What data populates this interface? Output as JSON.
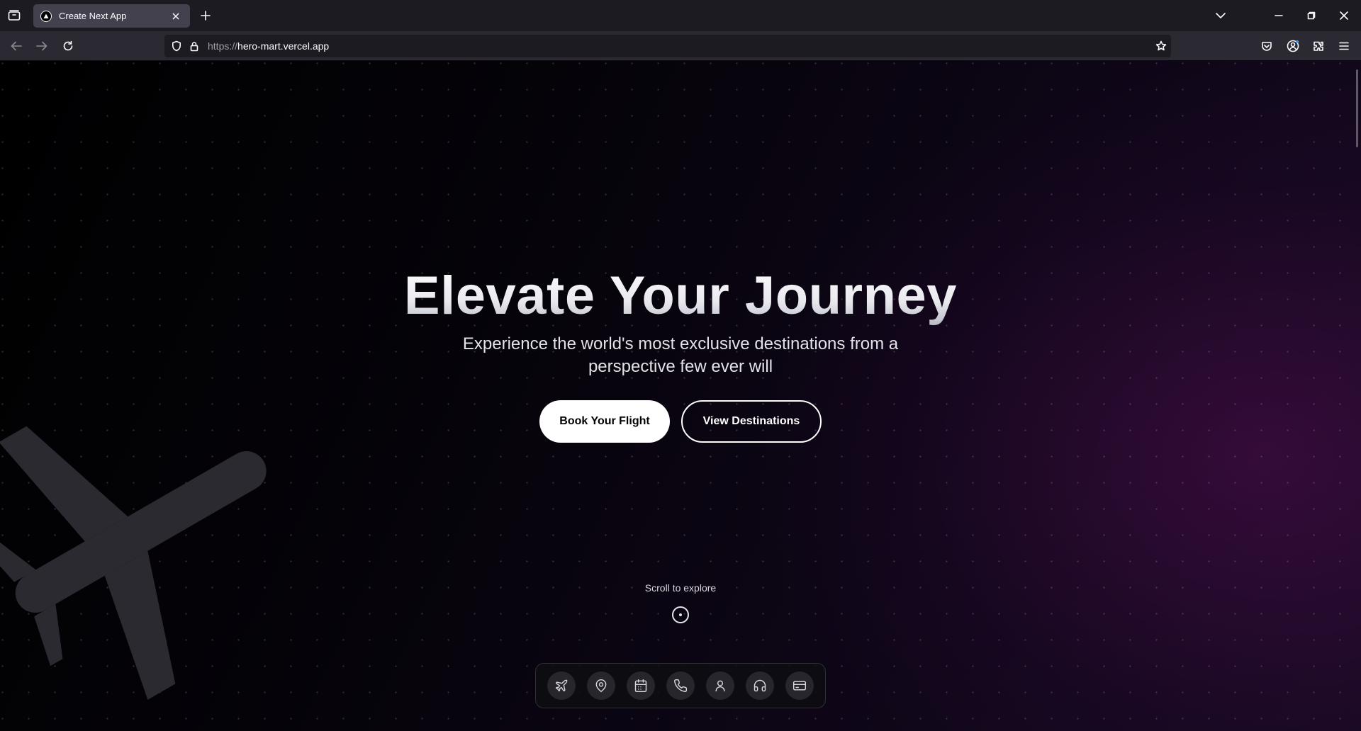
{
  "browser": {
    "tab": {
      "title": "Create Next App"
    },
    "url": {
      "protocol": "https://",
      "host": "hero-mart.vercel.app"
    }
  },
  "hero": {
    "title": "Elevate Your Journey",
    "subtitle": "Experience the world's most exclusive destinations from a perspective few ever will",
    "primary_button": "Book Your Flight",
    "secondary_button": "View Destinations",
    "scroll_label": "Scroll to explore"
  },
  "dock": {
    "items": [
      {
        "icon": "plane-icon"
      },
      {
        "icon": "map-pin-icon"
      },
      {
        "icon": "calendar-icon"
      },
      {
        "icon": "phone-icon"
      },
      {
        "icon": "user-icon"
      },
      {
        "icon": "headphones-icon"
      },
      {
        "icon": "credit-card-icon"
      }
    ]
  },
  "colors": {
    "chrome_bg": "#1c1b22",
    "active_tab": "#42414d",
    "page_bg": "#000000",
    "accent_glow": "#500e4e"
  }
}
